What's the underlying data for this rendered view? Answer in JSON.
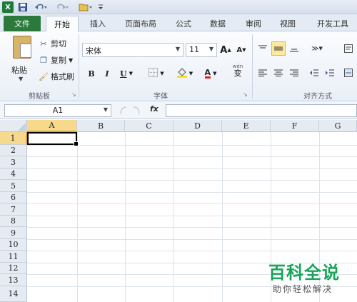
{
  "quick_access": {
    "app_icon": "excel-icon",
    "app_letter": "X",
    "save_icon": "save-icon",
    "undo_icon": "undo-icon",
    "redo_icon": "redo-icon",
    "open_icon": "folder-open-icon",
    "customize_icon": "customize-arrow-icon"
  },
  "tabs": {
    "file": "文件",
    "items": [
      "开始",
      "插入",
      "页面布局",
      "公式",
      "数据",
      "审阅",
      "视图",
      "开发工具"
    ],
    "active": "开始"
  },
  "ribbon": {
    "clipboard": {
      "paste": "粘贴",
      "cut": "剪切",
      "copy": "复制",
      "format_painter": "格式刷",
      "group_label": "剪贴板"
    },
    "font": {
      "font_name": "宋体",
      "font_size": "11",
      "grow": "A",
      "shrink": "A",
      "bold": "B",
      "italic": "I",
      "underline": "U",
      "font_color": "A",
      "phonetic": "wén",
      "phonetic_char": "变",
      "group_label": "字体"
    },
    "alignment": {
      "group_label": "对齐方式"
    }
  },
  "formula_bar": {
    "name_box": "A1",
    "fx": "fx",
    "formula": ""
  },
  "grid": {
    "columns": [
      "A",
      "B",
      "C",
      "D",
      "E",
      "F",
      "G"
    ],
    "rows": [
      "1",
      "2",
      "3",
      "4",
      "5",
      "6",
      "7",
      "8",
      "9",
      "10",
      "11",
      "12",
      "13",
      "14"
    ],
    "active_cell": "A1"
  },
  "watermark": {
    "title": "百科全说",
    "subtitle": "助你轻松解决"
  },
  "colors": {
    "file_tab": "#2b7a3b",
    "active_header": "#f7d98b",
    "watermark": "#17a55a"
  }
}
